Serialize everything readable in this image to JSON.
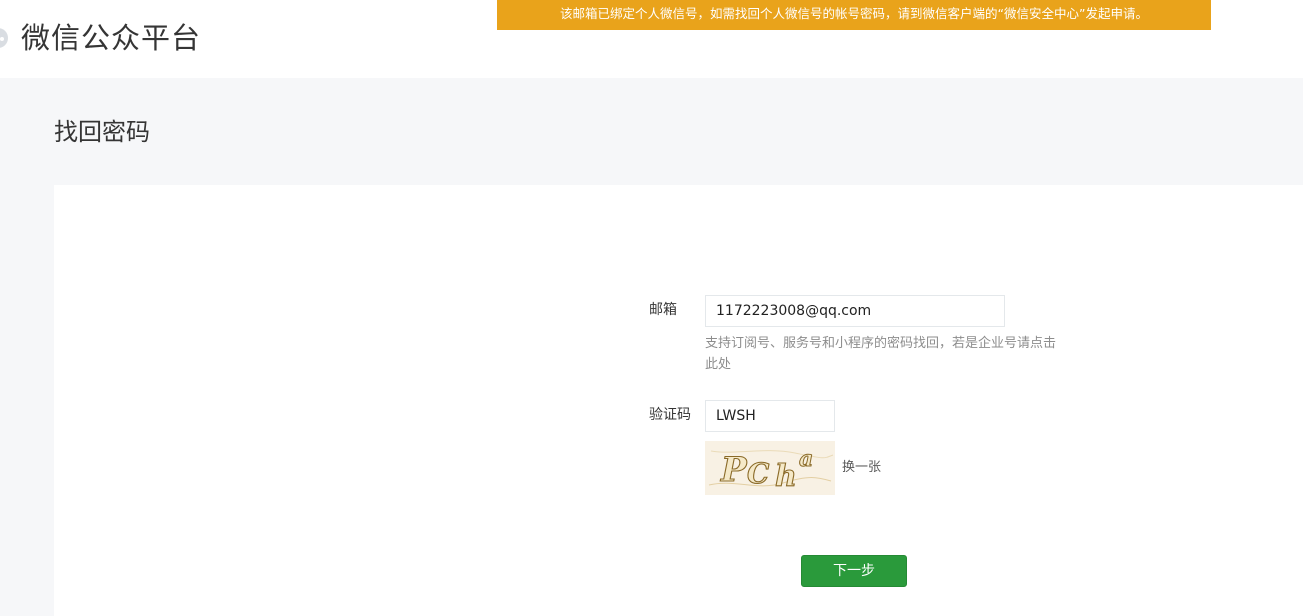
{
  "header": {
    "logo_icon": "wechat-bubble-icon",
    "logo_text": "微信公众平台"
  },
  "notice": {
    "text": "该邮箱已绑定个人微信号，如需找回个人微信号的帐号密码，请到微信客户端的“微信安全中心”发起申请。",
    "color": "#e9a31b"
  },
  "page": {
    "title": "找回密码"
  },
  "form": {
    "email_label": "邮箱",
    "email_value": "1172223008@qq.com",
    "tip_text": "支持订阅号、服务号和小程序的密码找回，若是企业号请",
    "tip_link": "点击此处",
    "captcha_label": "验证码",
    "captcha_value": "LWSH",
    "captcha_image_text": "PCha",
    "refresh_label": "换一张",
    "next_label": "下一步",
    "button_color": "#2a9a3b"
  }
}
